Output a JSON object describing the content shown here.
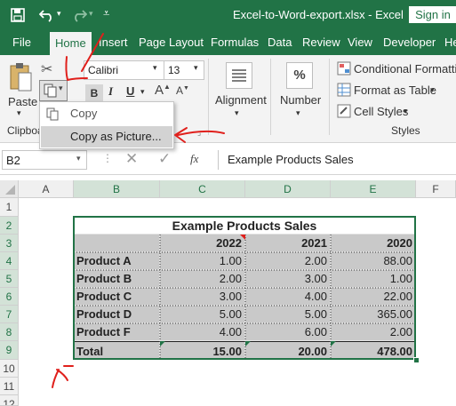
{
  "window": {
    "title": "Excel-to-Word-export.xlsx  -  Excel",
    "signin": "Sign in"
  },
  "tabs": [
    "File",
    "Home",
    "Insert",
    "Page Layout",
    "Formulas",
    "Data",
    "Review",
    "View",
    "Developer",
    "He"
  ],
  "ribbon": {
    "paste": "Paste",
    "clipboard_group": "Clipboa",
    "font_name": "Calibri",
    "font_size": "13",
    "alignment": "Alignment",
    "number": "Number",
    "number_symbol": "%",
    "conditional": "Conditional Formatting",
    "format_table": "Format as Table",
    "cell_styles": "Cell Styles",
    "styles_group": "Styles"
  },
  "copy_menu": {
    "copy": "Copy",
    "copy_as_picture": "Copy as Picture..."
  },
  "formula_bar": {
    "name_box": "B2",
    "fx": "fx",
    "content": "Example Products Sales"
  },
  "columns": [
    "A",
    "B",
    "C",
    "D",
    "E",
    "F"
  ],
  "rows": [
    "1",
    "2",
    "3",
    "4",
    "5",
    "6",
    "7",
    "8",
    "9",
    "10",
    "11",
    "12"
  ],
  "table": {
    "title": "Example Products Sales",
    "years": [
      "2022",
      "2021",
      "2020"
    ],
    "products": [
      {
        "name": "Product A",
        "values": [
          "1.00",
          "2.00",
          "88.00"
        ]
      },
      {
        "name": "Product B",
        "values": [
          "2.00",
          "3.00",
          "1.00"
        ]
      },
      {
        "name": "Product C",
        "values": [
          "3.00",
          "4.00",
          "22.00"
        ]
      },
      {
        "name": "Product D",
        "values": [
          "5.00",
          "5.00",
          "365.00"
        ]
      },
      {
        "name": "Product F",
        "values": [
          "4.00",
          "6.00",
          "2.00"
        ]
      }
    ],
    "total": {
      "name": "Total",
      "values": [
        "15.00",
        "20.00",
        "478.00"
      ]
    }
  },
  "colors": {
    "excel_green": "#217346",
    "annotation_red": "#e0201c",
    "cell_gray": "#c9c9c9"
  }
}
